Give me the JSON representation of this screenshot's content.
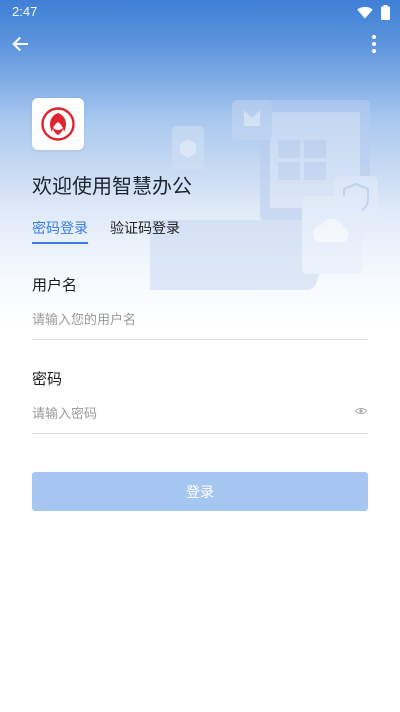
{
  "status_bar": {
    "time": "2:47",
    "icons": [
      "wifi-icon",
      "battery-icon"
    ]
  },
  "toolbar": {
    "back_icon": "arrow-left-icon",
    "more_icon": "more-vert-icon"
  },
  "brand": {
    "logo_icon": "dongfeng-logo-icon",
    "logo_color": "#e0242d"
  },
  "welcome_title": "欢迎使用智慧办公",
  "tabs": [
    {
      "label": "密码登录",
      "active": true
    },
    {
      "label": "验证码登录",
      "active": false
    }
  ],
  "form": {
    "username_label": "用户名",
    "username_placeholder": "请输入您的用户名",
    "password_label": "密码",
    "password_placeholder": "请输入密码",
    "password_toggle_icon": "eye-icon"
  },
  "submit_label": "登录",
  "colors": {
    "accent": "#3a7ee0",
    "button_disabled": "#a6c6f2",
    "header_gradient_top": "#3f7fd6"
  }
}
